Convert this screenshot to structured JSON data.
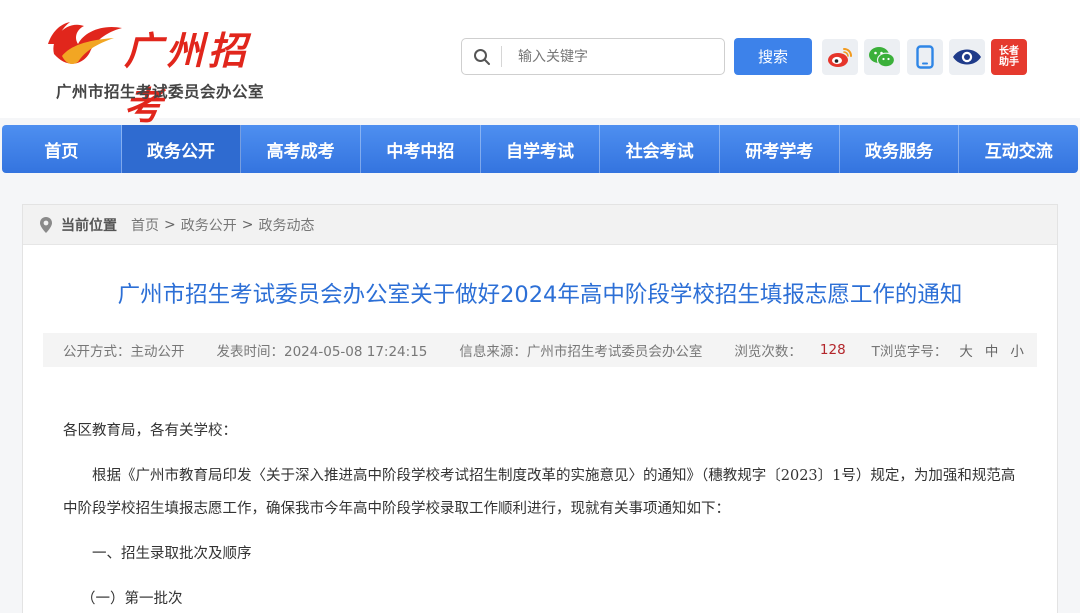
{
  "header": {
    "logo_text": "广州招考",
    "logo_subtitle": "广州市招生考试委员会办公室",
    "search_placeholder": "输入关键字",
    "search_button": "搜索",
    "elder_label_line1": "长者",
    "elder_label_line2": "助手"
  },
  "nav": {
    "items": [
      "首页",
      "政务公开",
      "高考成考",
      "中考中招",
      "自学考试",
      "社会考试",
      "研考学考",
      "政务服务",
      "互动交流"
    ],
    "active_index": 1
  },
  "breadcrumb": {
    "label": "当前位置",
    "items": [
      "首页",
      "政务公开",
      "政务动态"
    ],
    "separator": ">"
  },
  "article": {
    "title": "广州市招生考试委员会办公室关于做好2024年高中阶段学校招生填报志愿工作的通知",
    "meta": {
      "disclosure": "公开方式：主动公开",
      "published": "发表时间：2024-05-08 17:24:15",
      "source": "信息来源：广州市招生考试委员会办公室",
      "views_label": "浏览次数：",
      "views_value": "128",
      "font_label": "T浏览字号：",
      "font_large": "大",
      "font_medium": "中",
      "font_small": "小"
    },
    "paragraphs": [
      "各区教育局，各有关学校：",
      "根据《广州市教育局印发〈关于深入推进高中阶段学校考试招生制度改革的实施意见〉的通知》（穗教规字〔2023〕1号）规定，为加强和规范高中阶段学校招生填报志愿工作，确保我市今年高中阶段学校录取工作顺利进行，现就有关事项通知如下：",
      "一、招生录取批次及顺序",
      "（一）第一批次"
    ]
  },
  "colors": {
    "nav_blue": "#3a7be4",
    "title_blue": "#2c6fd6",
    "logo_red": "#e1261c",
    "views_red": "#b3262b"
  }
}
